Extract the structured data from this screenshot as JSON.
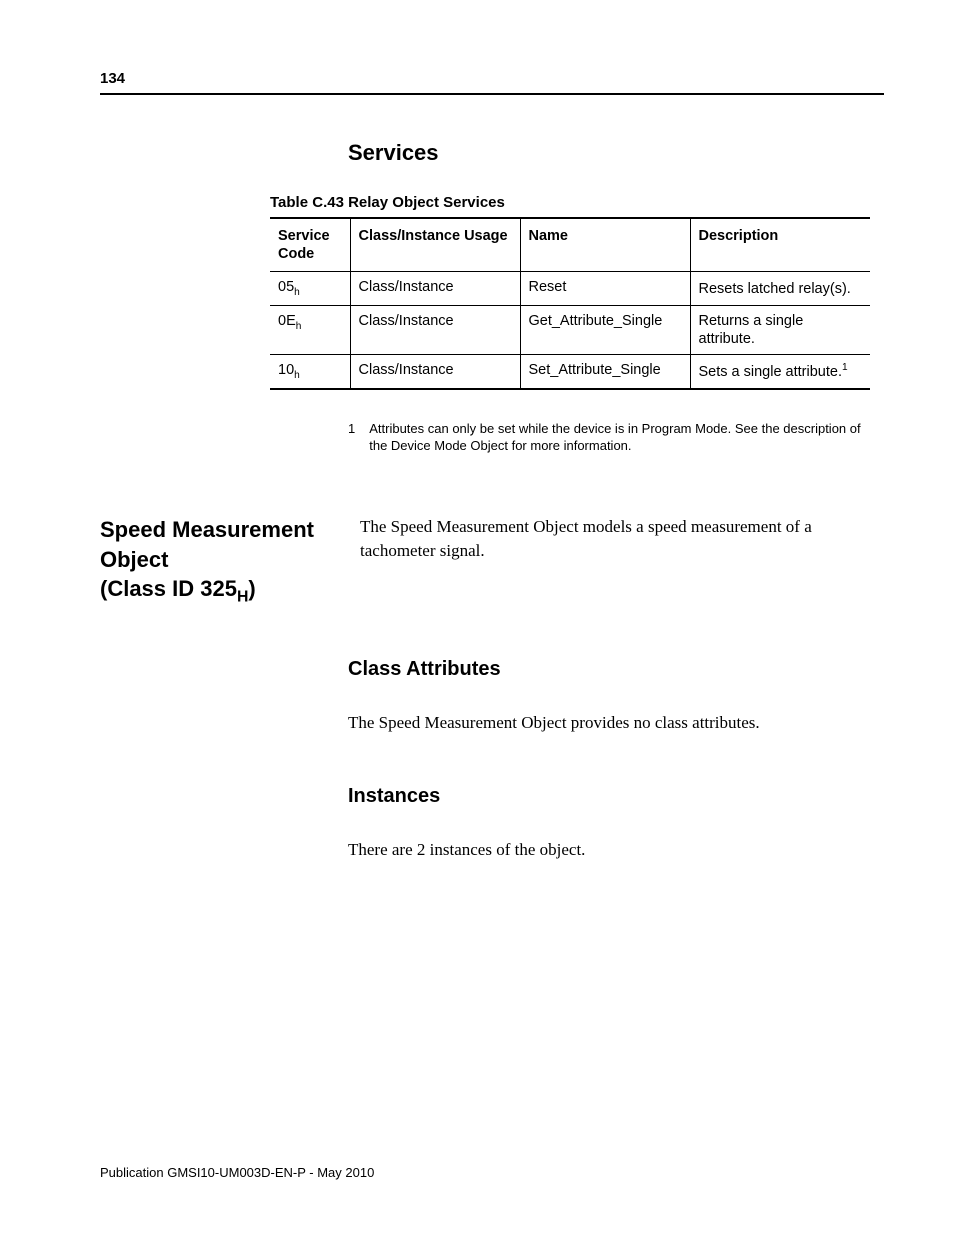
{
  "page_number": "134",
  "section_services": {
    "heading": "Services",
    "table_caption": "Table C.43 Relay Object Services",
    "columns": {
      "service_code": "Service Code",
      "usage": "Class/Instance Usage",
      "name": "Name",
      "description": "Description"
    },
    "rows": [
      {
        "code_base": "05",
        "code_sub": "h",
        "usage": "Class/Instance",
        "name": "Reset",
        "description": "Resets latched relay(s).",
        "desc_sup": ""
      },
      {
        "code_base": "0E",
        "code_sub": "h",
        "usage": "Class/Instance",
        "name": "Get_Attribute_Single",
        "description": "Returns a single attribute.",
        "desc_sup": ""
      },
      {
        "code_base": "10",
        "code_sub": "h",
        "usage": "Class/Instance",
        "name": "Set_Attribute_Single",
        "description": "Sets a single attribute.",
        "desc_sup": "1"
      }
    ],
    "footnote": {
      "num": "1",
      "text": "Attributes can only be set while the device is in Program Mode. See the description of the Device Mode Object for more information."
    }
  },
  "section_speed": {
    "heading_line1": "Speed Measurement Object",
    "heading_line2_prefix": "(Class ID 325",
    "heading_line2_sub": "H",
    "heading_line2_suffix": ")",
    "intro": "The Speed Measurement Object models a speed measurement of a tachometer signal.",
    "class_attr_heading": "Class Attributes",
    "class_attr_body": "The Speed Measurement Object provides no class attributes.",
    "instances_heading": "Instances",
    "instances_body": "There are 2 instances of the object."
  },
  "footer": "Publication GMSI10-UM003D-EN-P - May 2010"
}
